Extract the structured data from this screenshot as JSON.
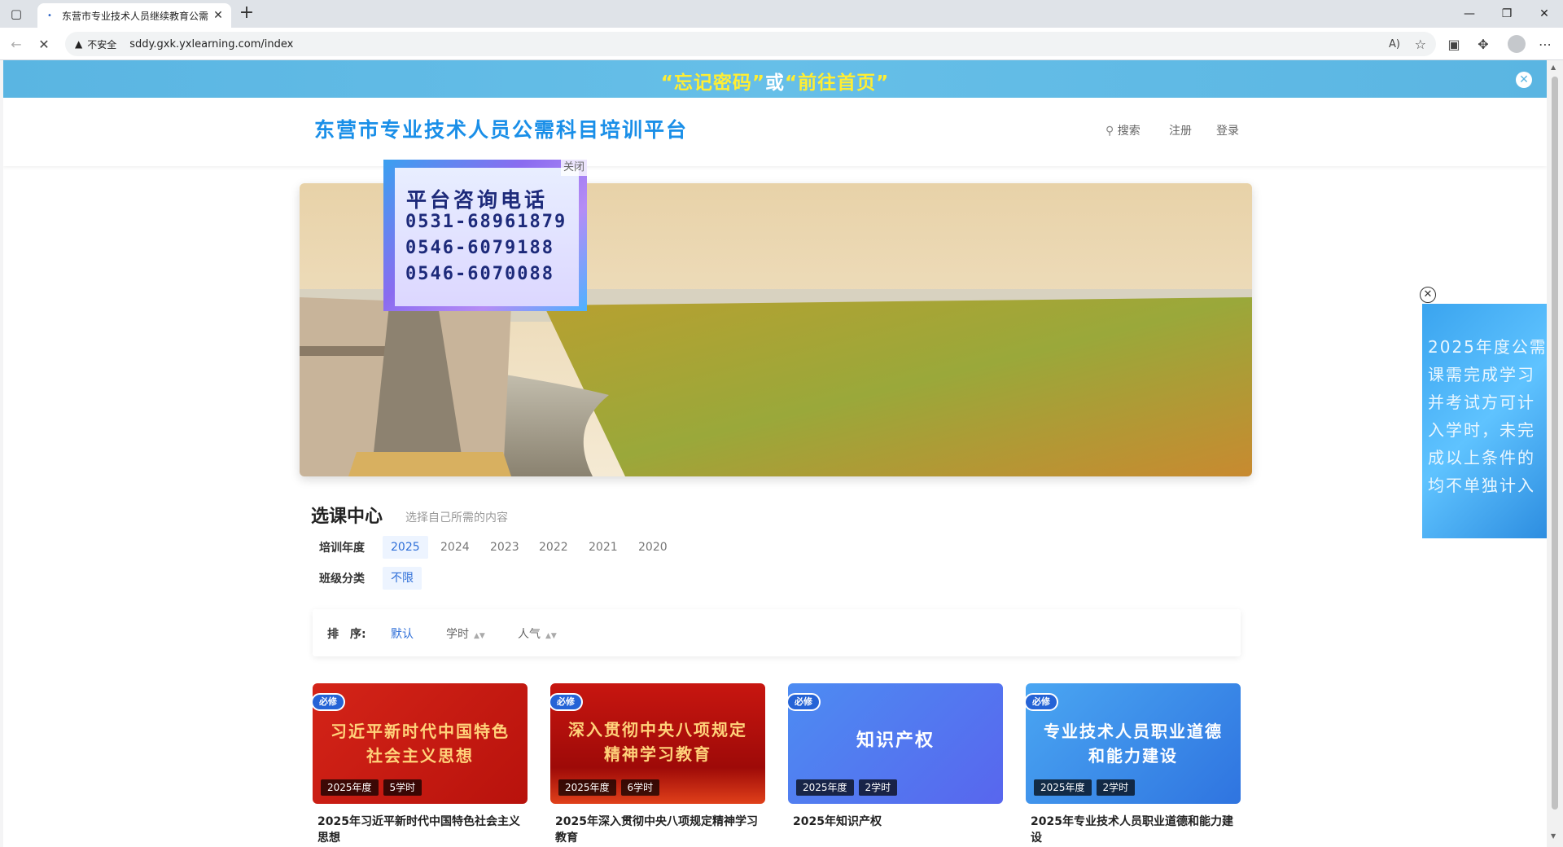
{
  "browser": {
    "tab_title": "东营市专业技术人员继续教育公需",
    "tab_close": "✕",
    "new_tab": "+",
    "url_warning": "不安全",
    "url": "sddy.gxk.yxlearning.com/index",
    "read_aloud": "A)"
  },
  "topbar": {
    "tip_left": "“忘记密码”",
    "tip_or": "或",
    "tip_right": "“前往首页”",
    "close": "✕"
  },
  "header": {
    "logo": "东营市专业技术人员公需科目培训平台",
    "search": "搜索",
    "register": "注册",
    "login": "登录"
  },
  "popup": {
    "close": "关闭",
    "title": "平台咨询电话",
    "phones": [
      "0531-68961879",
      "0546-6079188",
      "0546-6070088"
    ]
  },
  "side_float": {
    "close": "✕",
    "lines": [
      "2025年度公需",
      "课需完成学习",
      "并考试方可计",
      "入学时，未完",
      "成以上条件的",
      "均不单独计入"
    ]
  },
  "course_center": {
    "title": "选课中心",
    "subtitle": "选择自己所需的内容",
    "year_label": "培训年度",
    "years": [
      "2025",
      "2024",
      "2023",
      "2022",
      "2021",
      "2020"
    ],
    "class_label": "班级分类",
    "classes": [
      "不限"
    ]
  },
  "sort": {
    "label": "排　序:",
    "items": [
      "默认",
      "学时",
      "人气"
    ]
  },
  "courses": [
    {
      "badge": "必修",
      "cover_lines": [
        "习近平新时代中国特色",
        "社会主义思想"
      ],
      "year": "2025年度",
      "hours": "5学时",
      "name": "2025年习近平新时代中国特色社会主义思想",
      "color": "#c81a12"
    },
    {
      "badge": "必修",
      "cover_lines": [
        "深入贯彻中央八项规定",
        "精神学习教育"
      ],
      "year": "2025年度",
      "hours": "6学时",
      "name": "2025年深入贯彻中央八项规定精神学习教育",
      "color": "#b3100c"
    },
    {
      "badge": "必修",
      "cover_lines": [
        "知识产权"
      ],
      "year": "2025年度",
      "hours": "2学时",
      "name": "2025年知识产权",
      "color": "#4a6cf0"
    },
    {
      "badge": "必修",
      "cover_lines": [
        "专业技术人员职业道德",
        "和能力建设"
      ],
      "year": "2025年度",
      "hours": "2学时",
      "name": "2025年专业技术人员职业道德和能力建设",
      "color": "#3d7ee8"
    }
  ]
}
